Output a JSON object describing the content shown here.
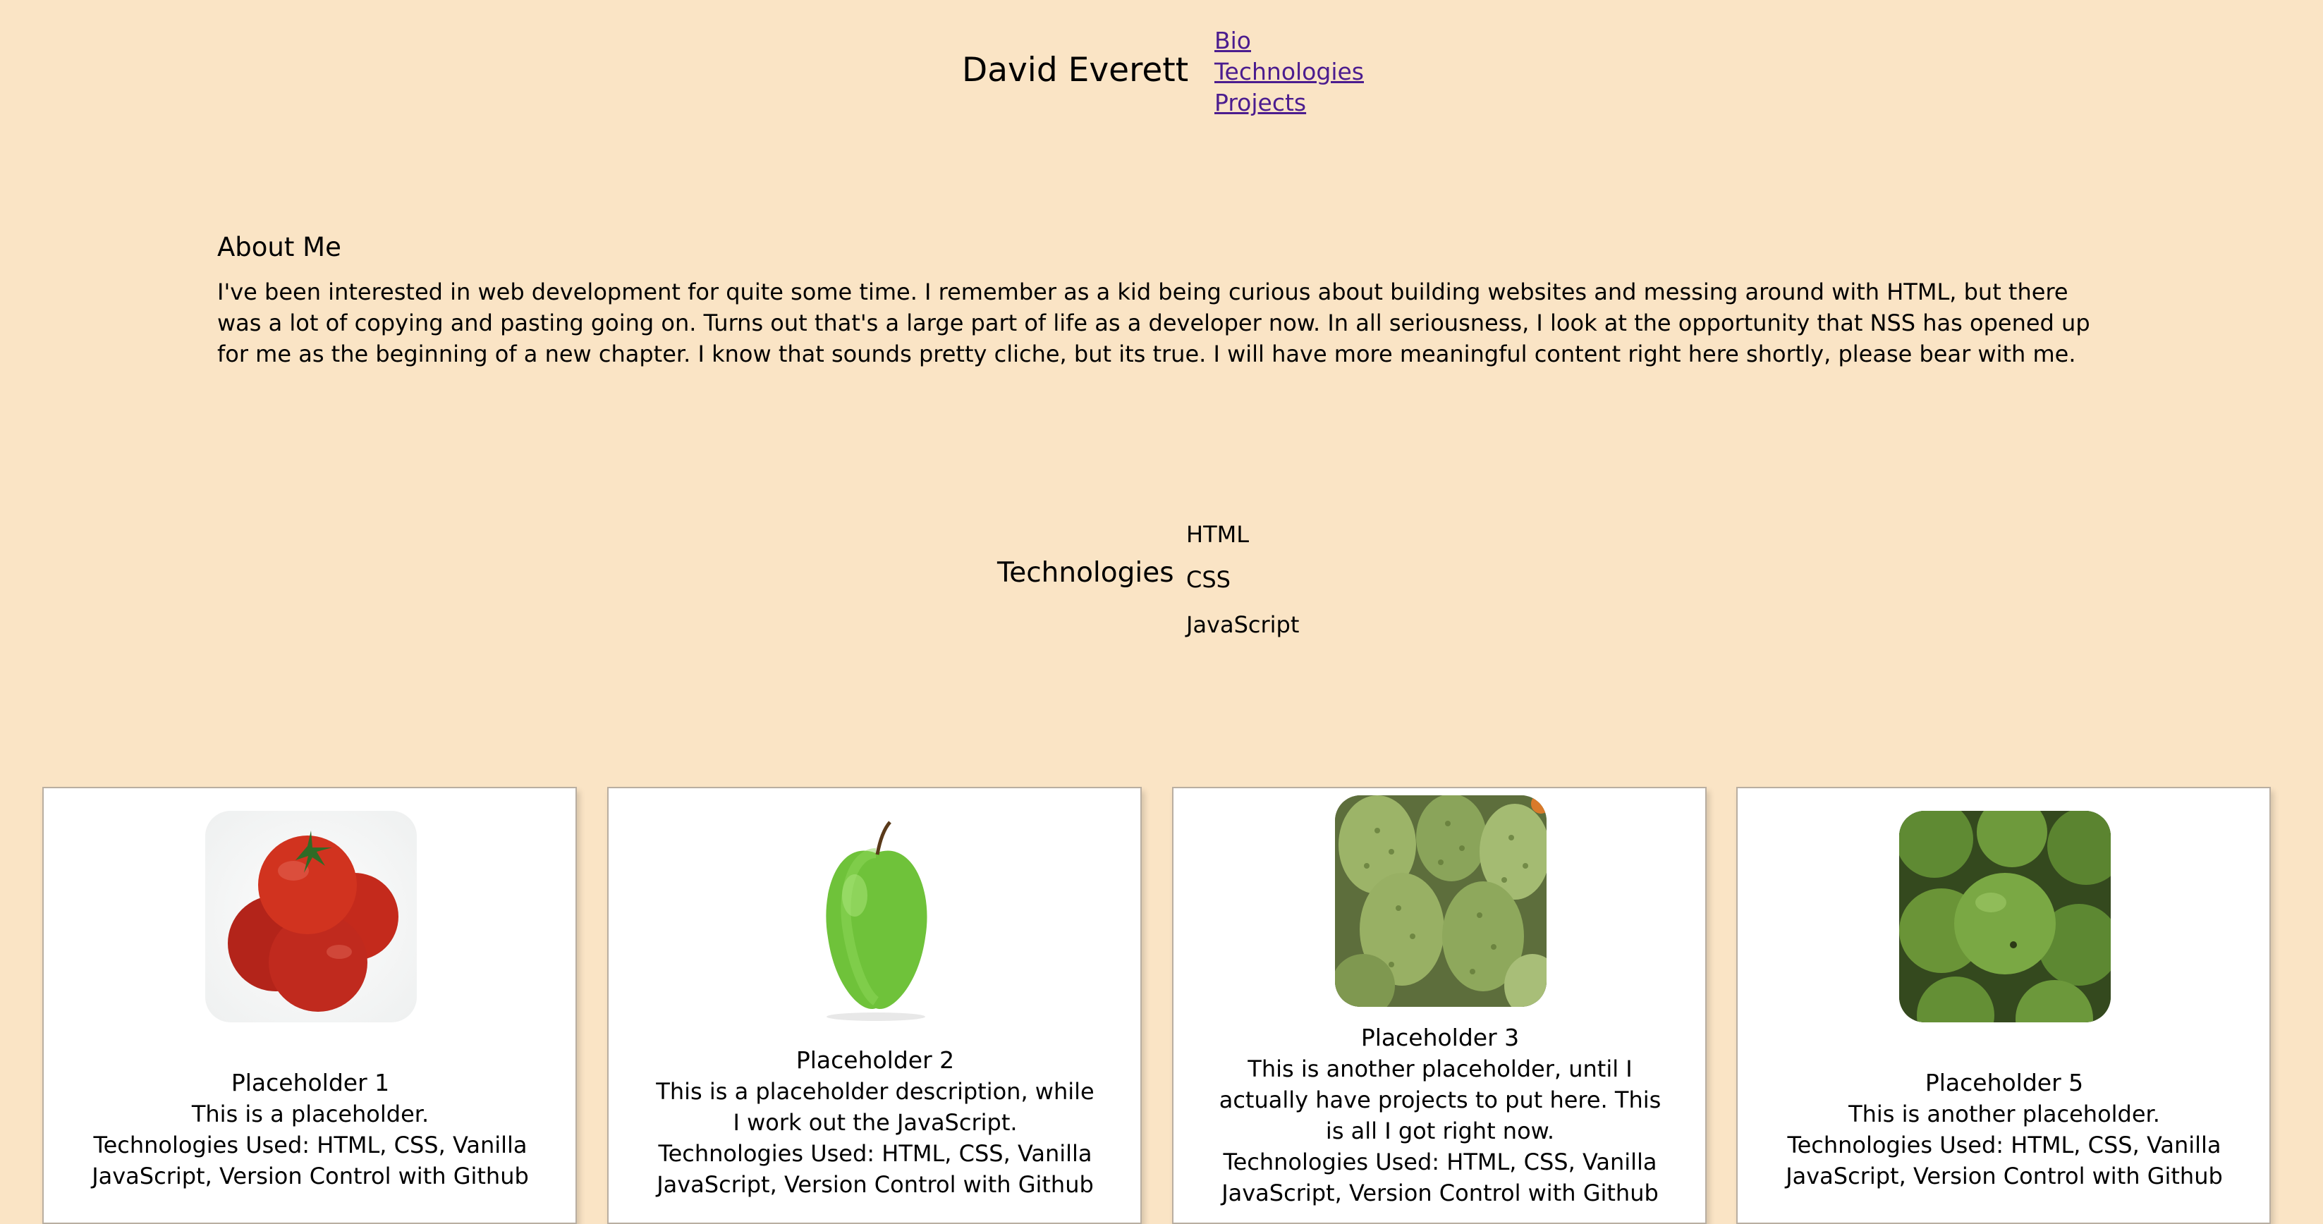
{
  "header": {
    "title": "David Everett",
    "nav": [
      {
        "label": "Bio"
      },
      {
        "label": "Technologies"
      },
      {
        "label": "Projects"
      }
    ]
  },
  "about": {
    "heading": "About Me",
    "text": "I've been interested in web development for quite some time. I remember as a kid being curious about building websites and messing around with HTML, but there was a lot of copying and pasting going on. Turns out that's a large part of life as a developer now. In all seriousness, I look at the opportunity that NSS has opened up for me as the beginning of a new chapter. I know that sounds pretty cliche, but its true. I will have more meaningful content right here shortly, please bear with me."
  },
  "technologies": {
    "heading": "Technologies",
    "items": [
      "HTML",
      "CSS",
      "JavaScript"
    ]
  },
  "projects": [
    {
      "title": "Placeholder 1",
      "description": "This is a placeholder.",
      "tech": "Technologies Used: HTML, CSS, Vanilla JavaScript, Version Control with Github",
      "image": "tomatoes-image"
    },
    {
      "title": "Placeholder 2",
      "description": "This is a placeholder description, while I work out the JavaScript.",
      "tech": "Technologies Used: HTML, CSS, Vanilla JavaScript, Version Control with Github",
      "image": "green-apple-image"
    },
    {
      "title": "Placeholder 3",
      "description": "This is another placeholder, until I actually have projects to put here. This is all I got right now.",
      "tech": "Technologies Used: HTML, CSS, Vanilla JavaScript, Version Control with Github",
      "image": "soursop-image"
    },
    {
      "title": "Placeholder 5",
      "description": "This is another placeholder.",
      "tech": "Technologies Used: HTML, CSS, Vanilla JavaScript, Version Control with Github",
      "image": "green-fruit-image"
    }
  ],
  "colors": {
    "background": "#fae4c5",
    "link": "#4b1c8f",
    "card": "#ffffff"
  }
}
